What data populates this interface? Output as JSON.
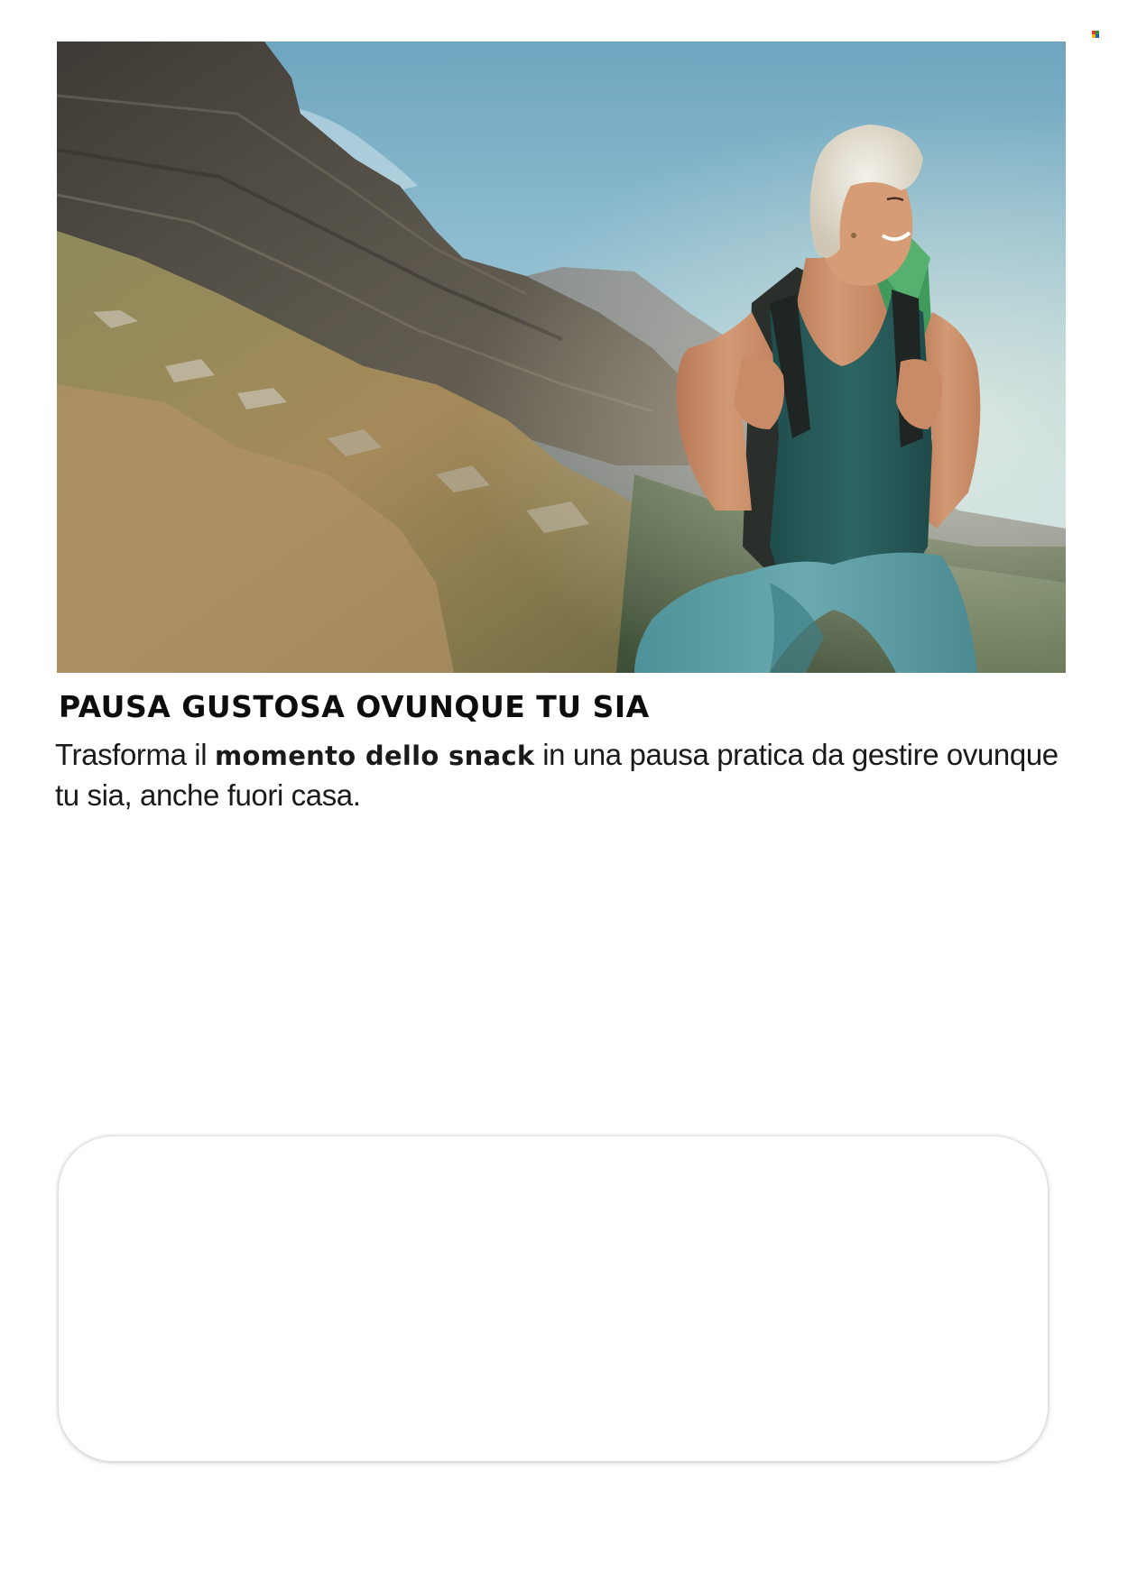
{
  "hero": {
    "alt": "Hiker woman smiling on a mountain trail with a green backpack"
  },
  "content": {
    "headline": "PAUSA GUSTOSA OVUNQUE TU SIA",
    "body_part1": "Trasforma il ",
    "body_bold": "momento dello snack",
    "body_part2": " in una pausa pratica da gestire ovunque tu sia, anche fuori casa."
  },
  "colors": {
    "sky": "#7fb4cc",
    "rock": "#4d4a44",
    "grass": "#a08a5c",
    "tank_top": "#2a5e5c",
    "hair": "#e9e4d8",
    "skin": "#c98a66",
    "shirt_tied": "#5c9ea4",
    "backpack": "#3f9a5c"
  }
}
